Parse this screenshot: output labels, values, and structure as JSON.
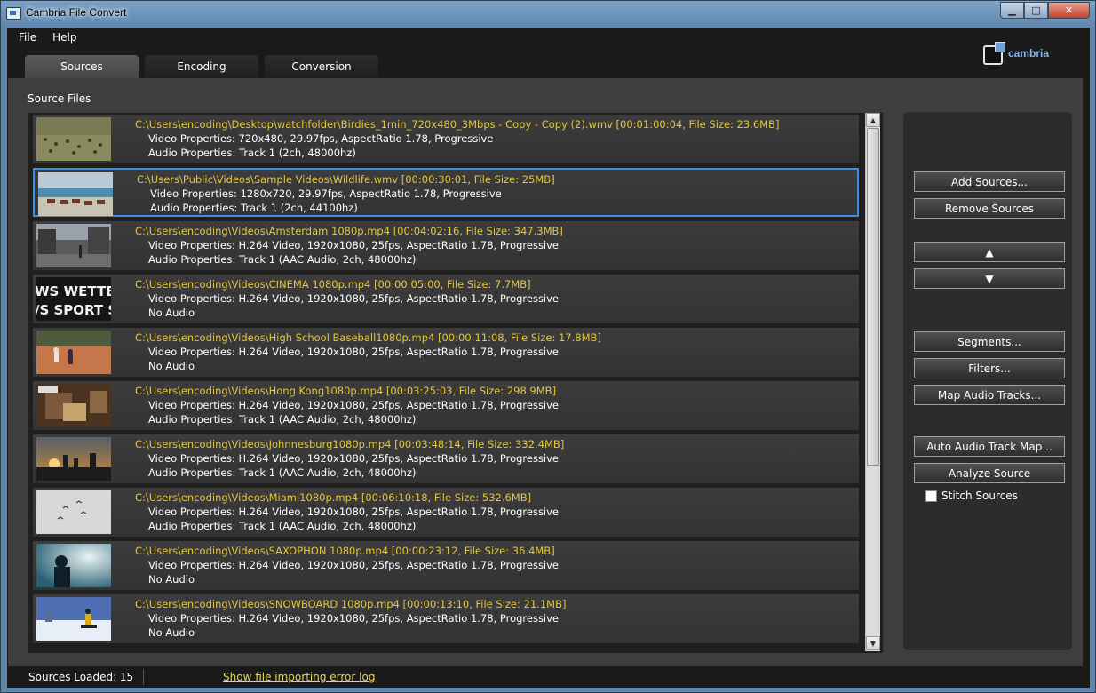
{
  "window": {
    "title": "Cambria File Convert",
    "min_glyph": "▁",
    "max_glyph": "□",
    "close_glyph": "✕"
  },
  "menu": [
    "File",
    "Help"
  ],
  "logo_text": "cambria",
  "tabs": [
    {
      "label": "Sources",
      "active": true
    },
    {
      "label": "Encoding",
      "active": false
    },
    {
      "label": "Conversion",
      "active": false
    }
  ],
  "section_label": "Source Files",
  "sources": [
    {
      "path": "C:\\Users\\encoding\\Desktop\\watchfolder\\Birdies_1min_720x480_3Mbps - Copy - Copy (2).wmv [00:01:00:04, File Size: 23.6MB]",
      "video": "Video Properties: 720x480, 29.97fps, AspectRatio 1.78, Progressive",
      "audio": "Audio Properties:  Track 1 (2ch, 48000hz)",
      "thumb": "birds-field",
      "selected": false
    },
    {
      "path": "C:\\Users\\Public\\Videos\\Sample Videos\\Wildlife.wmv [00:00:30:01, File Size: 25MB]",
      "video": "Video Properties: 1280x720, 29.97fps, AspectRatio 1.78, Progressive",
      "audio": "Audio Properties:  Track 1 (2ch, 44100hz)",
      "thumb": "beach-horses",
      "selected": true
    },
    {
      "path": "C:\\Users\\encoding\\Videos\\Amsterdam 1080p.mp4 [00:04:02:16, File Size: 347.3MB]",
      "video": "Video Properties: H.264 Video, 1920x1080, 25fps, AspectRatio 1.78, Progressive",
      "audio": "Audio Properties:  Track 1 (AAC Audio, 2ch, 48000hz)",
      "thumb": "city-street",
      "selected": false
    },
    {
      "path": "C:\\Users\\encoding\\Videos\\CINEMA 1080p.mp4 [00:00:05:00, File Size: 7.7MB]",
      "video": "Video Properties: H.264 Video, 1920x1080, 25fps, AspectRatio 1.78, Progressive",
      "audio": "No Audio",
      "thumb": "text-screen",
      "selected": false,
      "thumb_text_1": "WS WETTER",
      "thumb_text_2": "/S SPORT SC"
    },
    {
      "path": "C:\\Users\\encoding\\Videos\\High School Baseball1080p.mp4 [00:00:11:08, File Size: 17.8MB]",
      "video": "Video Properties: H.264 Video, 1920x1080, 25fps, AspectRatio 1.78, Progressive",
      "audio": "No Audio",
      "thumb": "baseball",
      "selected": false
    },
    {
      "path": "C:\\Users\\encoding\\Videos\\Hong Kong1080p.mp4 [00:03:25:03, File Size: 298.9MB]",
      "video": "Video Properties: H.264 Video, 1920x1080, 25fps, AspectRatio 1.78, Progressive",
      "audio": "Audio Properties:  Track 1 (AAC Audio, 2ch, 48000hz)",
      "thumb": "market",
      "selected": false
    },
    {
      "path": "C:\\Users\\encoding\\Videos\\Johnnesburg1080p.mp4 [00:03:48:14, File Size: 332.4MB]",
      "video": "Video Properties: H.264 Video, 1920x1080, 25fps, AspectRatio 1.78, Progressive",
      "audio": "Audio Properties:  Track 1 (AAC Audio, 2ch, 48000hz)",
      "thumb": "sunset-skyline",
      "selected": false
    },
    {
      "path": "C:\\Users\\encoding\\Videos\\Miami1080p.mp4 [00:06:10:18, File Size: 532.6MB]",
      "video": "Video Properties: H.264 Video, 1920x1080, 25fps, AspectRatio 1.78, Progressive",
      "audio": "Audio Properties:  Track 1 (AAC Audio, 2ch, 48000hz)",
      "thumb": "birds-sky",
      "selected": false
    },
    {
      "path": "C:\\Users\\encoding\\Videos\\SAXOPHON 1080p.mp4 [00:00:23:12, File Size: 36.4MB]",
      "video": "Video Properties: H.264 Video, 1920x1080, 25fps, AspectRatio 1.78, Progressive",
      "audio": "No Audio",
      "thumb": "saxophone",
      "selected": false
    },
    {
      "path": "C:\\Users\\encoding\\Videos\\SNOWBOARD 1080p.mp4 [00:00:13:10, File Size: 21.1MB]",
      "video": "Video Properties: H.264 Video, 1920x1080, 25fps, AspectRatio 1.78, Progressive",
      "audio": "No Audio",
      "thumb": "snowboard",
      "selected": false
    }
  ],
  "scroll": {
    "up_glyph": "▲",
    "down_glyph": "▼"
  },
  "buttons": {
    "add_sources": "Add Sources...",
    "remove_sources": "Remove Sources",
    "move_up": "▲",
    "move_down": "▼",
    "segments": "Segments...",
    "filters": "Filters...",
    "map_audio": "Map Audio Tracks...",
    "auto_audio": "Auto Audio Track Map...",
    "analyze": "Analyze Source"
  },
  "stitch_sources": {
    "label": "Stitch Sources",
    "checked": false
  },
  "status": {
    "loaded": "Sources Loaded: 15",
    "error_log_link": "Show file importing error log"
  }
}
